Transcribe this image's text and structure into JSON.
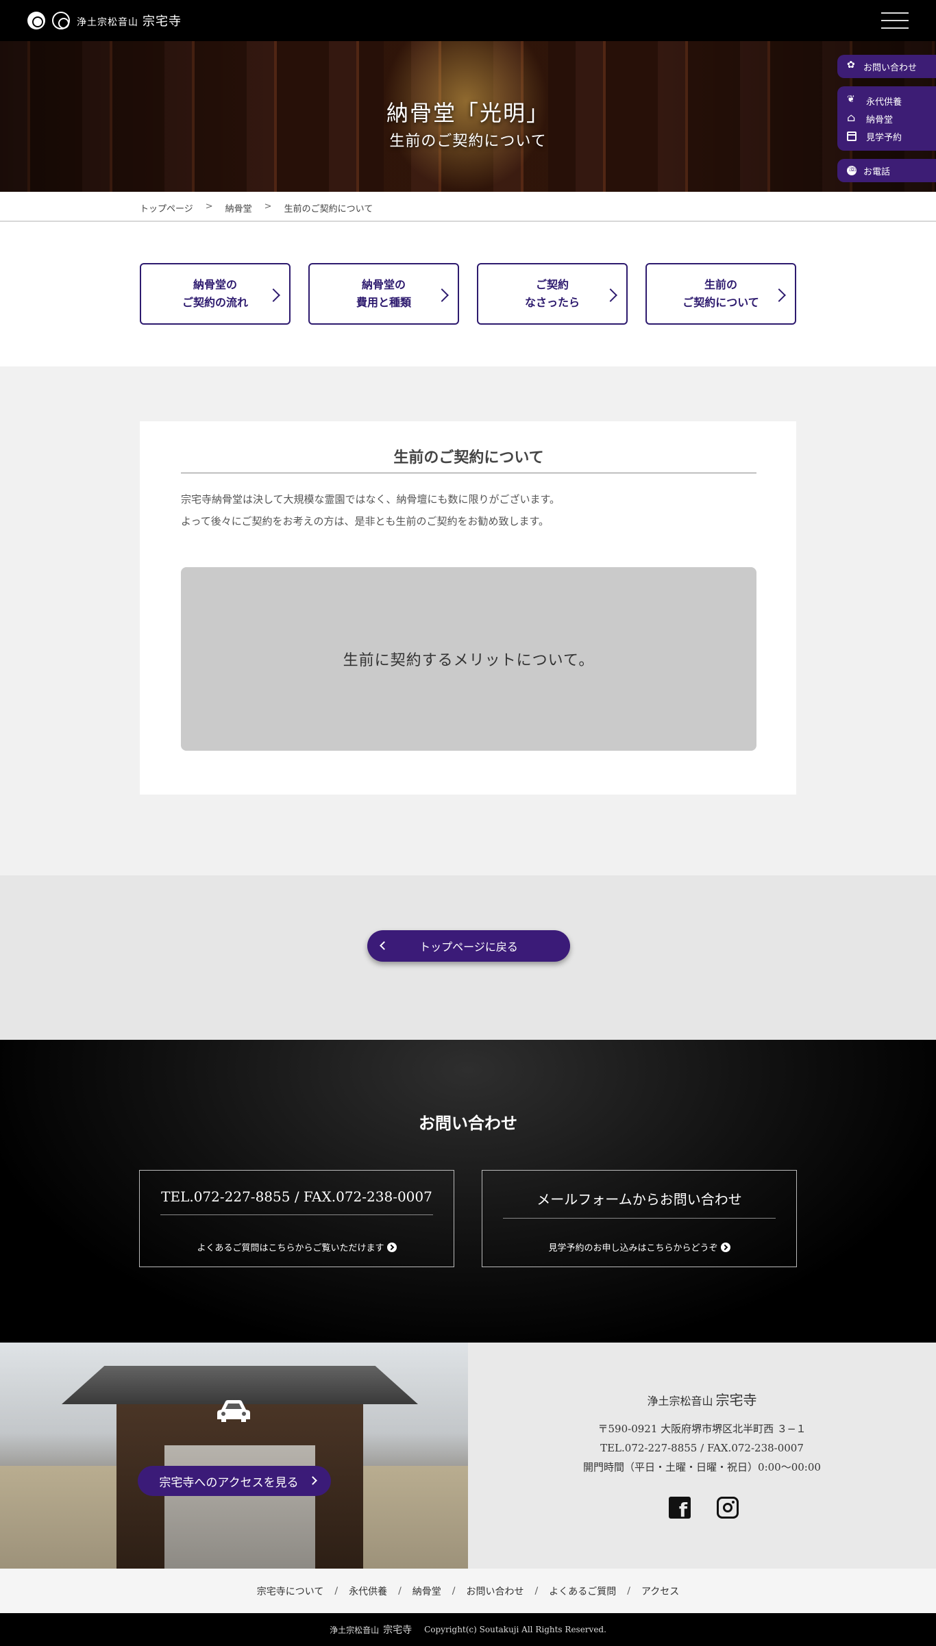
{
  "header": {
    "brand_small": "浄土宗松音山",
    "brand_large": "宗宅寺"
  },
  "hero": {
    "title": "納骨堂「光明」",
    "subtitle": "生前のご契約について"
  },
  "side_nav": {
    "contact": "お問い合わせ",
    "group": [
      "永代供養",
      "納骨堂",
      "見学予約"
    ],
    "phone": "お電話"
  },
  "breadcrumb": {
    "items": [
      "トップページ",
      "納骨堂",
      "生前のご契約について"
    ],
    "separator": ">"
  },
  "cards": [
    {
      "label": "納骨堂の\nご契約の流れ"
    },
    {
      "label": "納骨堂の\n費用と種類"
    },
    {
      "label": "ご契約\nなさったら"
    },
    {
      "label": "生前の\nご契約について"
    }
  ],
  "content": {
    "title": "生前のご契約について",
    "paragraph_1": "宗宅寺納骨堂は決して大規模な霊園ではなく、納骨壇にも数に限りがございます。",
    "paragraph_2": "よって後々にご契約をお考えの方は、是非とも生前のご契約をお勧め致します。",
    "merit_box": "生前に契約するメリットについて。"
  },
  "back_button": "トップページに戻る",
  "contact": {
    "title": "お問い合わせ",
    "tel_fax": "TEL.072-227-8855 / FAX.072-238-0007",
    "tel_sub": "よくあるご質問はこちらからご覧いただけます",
    "mail": "メールフォームからお問い合わせ",
    "mail_sub": "見学予約のお申し込みはこちらからどうぞ"
  },
  "access": {
    "button": "宗宅寺へのアクセスを見る"
  },
  "info": {
    "name_small": "浄土宗松音山",
    "name_large": "宗宅寺",
    "address": "〒590-0921 大阪府堺市堺区北半町西 ３−１",
    "tel_fax": "TEL.072-227-8855 / FAX.072-238-0007",
    "hours": "開門時間（平日・土曜・日曜・祝日）0:00〜00:00"
  },
  "footer_nav": [
    "宗宅寺について",
    "永代供養",
    "納骨堂",
    "お問い合わせ",
    "よくあるご質問",
    "アクセス"
  ],
  "footer_sep": "/",
  "copyright": {
    "name_small": "浄土宗松音山",
    "name_large": "宗宅寺",
    "text": "Copyright(c) Soutakuji All Rights Reserved."
  },
  "colors": {
    "accent_purple": "#3b1b78",
    "card_border": "#2d1a6e"
  }
}
